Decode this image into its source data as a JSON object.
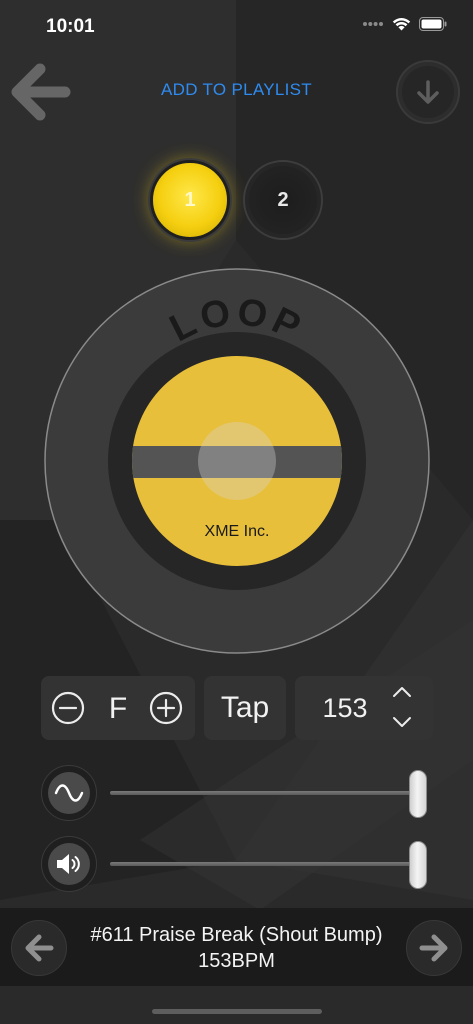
{
  "status_bar": {
    "time": "10:01",
    "signal_icon": "cellular-dots-icon",
    "wifi_icon": "wifi-icon",
    "battery_icon": "battery-icon"
  },
  "header": {
    "back_icon": "arrow-left-icon",
    "playlist_label": "ADD TO PLAYLIST",
    "download_icon": "arrow-down-icon",
    "link_color": "#2e8bf0"
  },
  "tracks": {
    "items": [
      {
        "label": "1",
        "active": true
      },
      {
        "label": "2",
        "active": false
      }
    ],
    "active_color": "#f5cf10"
  },
  "record": {
    "title": "LOOP",
    "company": "XME Inc.",
    "label_color": "#e8bf3a"
  },
  "controls": {
    "key_value": "F",
    "minus_icon": "minus-circle-icon",
    "plus_icon": "plus-circle-icon",
    "tap_label": "Tap",
    "bpm_value": "153",
    "up_icon": "chevron-up-icon",
    "down_icon": "chevron-down-icon"
  },
  "sliders": [
    {
      "icon": "sine-wave-icon",
      "value": 1.0
    },
    {
      "icon": "speaker-volume-icon",
      "value": 1.0
    }
  ],
  "now_playing": {
    "title": "#611 Praise Break (Shout Bump) 153BPM",
    "prev_icon": "arrow-left-icon",
    "next_icon": "arrow-right-icon"
  }
}
